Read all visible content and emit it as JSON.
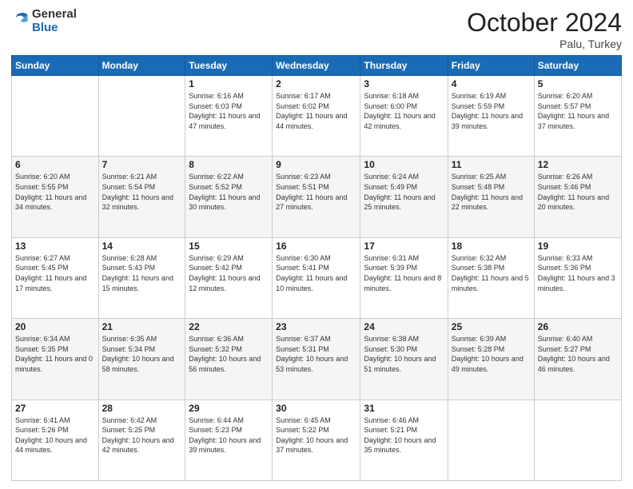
{
  "logo": {
    "general": "General",
    "blue": "Blue"
  },
  "header": {
    "month": "October 2024",
    "location": "Palu, Turkey"
  },
  "weekdays": [
    "Sunday",
    "Monday",
    "Tuesday",
    "Wednesday",
    "Thursday",
    "Friday",
    "Saturday"
  ],
  "weeks": [
    [
      {
        "day": "",
        "text": ""
      },
      {
        "day": "",
        "text": ""
      },
      {
        "day": "1",
        "text": "Sunrise: 6:16 AM\nSunset: 6:03 PM\nDaylight: 11 hours and 47 minutes."
      },
      {
        "day": "2",
        "text": "Sunrise: 6:17 AM\nSunset: 6:02 PM\nDaylight: 11 hours and 44 minutes."
      },
      {
        "day": "3",
        "text": "Sunrise: 6:18 AM\nSunset: 6:00 PM\nDaylight: 11 hours and 42 minutes."
      },
      {
        "day": "4",
        "text": "Sunrise: 6:19 AM\nSunset: 5:59 PM\nDaylight: 11 hours and 39 minutes."
      },
      {
        "day": "5",
        "text": "Sunrise: 6:20 AM\nSunset: 5:57 PM\nDaylight: 11 hours and 37 minutes."
      }
    ],
    [
      {
        "day": "6",
        "text": "Sunrise: 6:20 AM\nSunset: 5:55 PM\nDaylight: 11 hours and 34 minutes."
      },
      {
        "day": "7",
        "text": "Sunrise: 6:21 AM\nSunset: 5:54 PM\nDaylight: 11 hours and 32 minutes."
      },
      {
        "day": "8",
        "text": "Sunrise: 6:22 AM\nSunset: 5:52 PM\nDaylight: 11 hours and 30 minutes."
      },
      {
        "day": "9",
        "text": "Sunrise: 6:23 AM\nSunset: 5:51 PM\nDaylight: 11 hours and 27 minutes."
      },
      {
        "day": "10",
        "text": "Sunrise: 6:24 AM\nSunset: 5:49 PM\nDaylight: 11 hours and 25 minutes."
      },
      {
        "day": "11",
        "text": "Sunrise: 6:25 AM\nSunset: 5:48 PM\nDaylight: 11 hours and 22 minutes."
      },
      {
        "day": "12",
        "text": "Sunrise: 6:26 AM\nSunset: 5:46 PM\nDaylight: 11 hours and 20 minutes."
      }
    ],
    [
      {
        "day": "13",
        "text": "Sunrise: 6:27 AM\nSunset: 5:45 PM\nDaylight: 11 hours and 17 minutes."
      },
      {
        "day": "14",
        "text": "Sunrise: 6:28 AM\nSunset: 5:43 PM\nDaylight: 11 hours and 15 minutes."
      },
      {
        "day": "15",
        "text": "Sunrise: 6:29 AM\nSunset: 5:42 PM\nDaylight: 11 hours and 12 minutes."
      },
      {
        "day": "16",
        "text": "Sunrise: 6:30 AM\nSunset: 5:41 PM\nDaylight: 11 hours and 10 minutes."
      },
      {
        "day": "17",
        "text": "Sunrise: 6:31 AM\nSunset: 5:39 PM\nDaylight: 11 hours and 8 minutes."
      },
      {
        "day": "18",
        "text": "Sunrise: 6:32 AM\nSunset: 5:38 PM\nDaylight: 11 hours and 5 minutes."
      },
      {
        "day": "19",
        "text": "Sunrise: 6:33 AM\nSunset: 5:36 PM\nDaylight: 11 hours and 3 minutes."
      }
    ],
    [
      {
        "day": "20",
        "text": "Sunrise: 6:34 AM\nSunset: 5:35 PM\nDaylight: 11 hours and 0 minutes."
      },
      {
        "day": "21",
        "text": "Sunrise: 6:35 AM\nSunset: 5:34 PM\nDaylight: 10 hours and 58 minutes."
      },
      {
        "day": "22",
        "text": "Sunrise: 6:36 AM\nSunset: 5:32 PM\nDaylight: 10 hours and 56 minutes."
      },
      {
        "day": "23",
        "text": "Sunrise: 6:37 AM\nSunset: 5:31 PM\nDaylight: 10 hours and 53 minutes."
      },
      {
        "day": "24",
        "text": "Sunrise: 6:38 AM\nSunset: 5:30 PM\nDaylight: 10 hours and 51 minutes."
      },
      {
        "day": "25",
        "text": "Sunrise: 6:39 AM\nSunset: 5:28 PM\nDaylight: 10 hours and 49 minutes."
      },
      {
        "day": "26",
        "text": "Sunrise: 6:40 AM\nSunset: 5:27 PM\nDaylight: 10 hours and 46 minutes."
      }
    ],
    [
      {
        "day": "27",
        "text": "Sunrise: 6:41 AM\nSunset: 5:26 PM\nDaylight: 10 hours and 44 minutes."
      },
      {
        "day": "28",
        "text": "Sunrise: 6:42 AM\nSunset: 5:25 PM\nDaylight: 10 hours and 42 minutes."
      },
      {
        "day": "29",
        "text": "Sunrise: 6:44 AM\nSunset: 5:23 PM\nDaylight: 10 hours and 39 minutes."
      },
      {
        "day": "30",
        "text": "Sunrise: 6:45 AM\nSunset: 5:22 PM\nDaylight: 10 hours and 37 minutes."
      },
      {
        "day": "31",
        "text": "Sunrise: 6:46 AM\nSunset: 5:21 PM\nDaylight: 10 hours and 35 minutes."
      },
      {
        "day": "",
        "text": ""
      },
      {
        "day": "",
        "text": ""
      }
    ]
  ]
}
